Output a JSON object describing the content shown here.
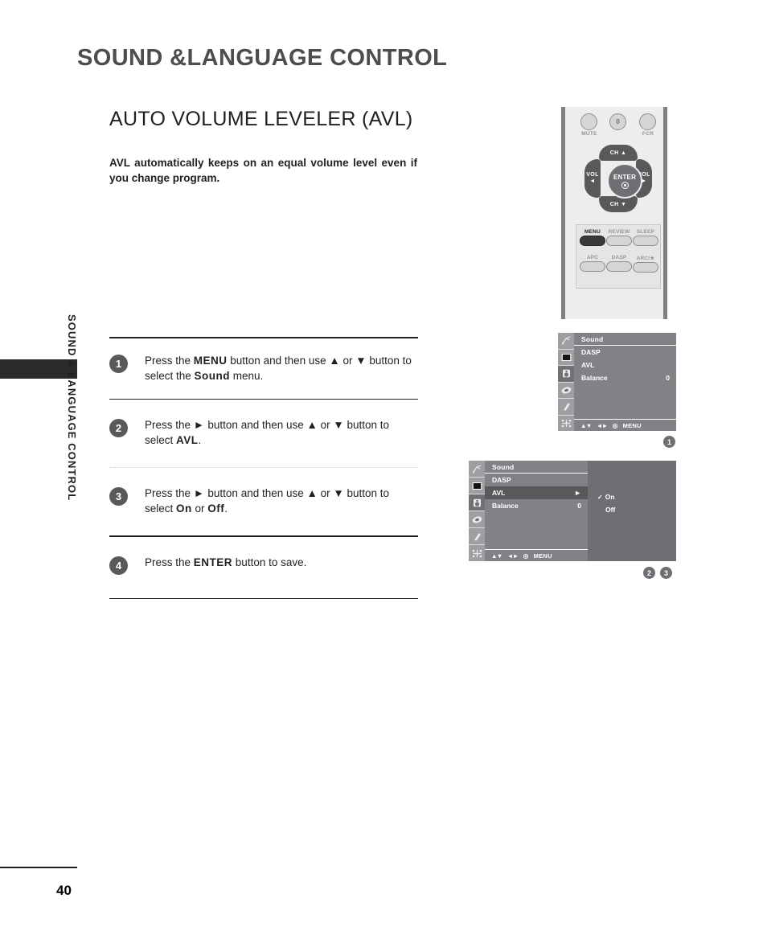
{
  "page": {
    "chapter_title": "SOUND &LANGUAGE CONTROL",
    "section_title": "AUTO VOLUME LEVELER (AVL)",
    "intro": "AVL automatically keeps on an equal volume level even if you change program.",
    "side_label": "SOUND & LANGUAGE CONTROL",
    "page_number": "40"
  },
  "steps": [
    {
      "num": "1",
      "parts": [
        {
          "t": "Press the ",
          "bold": false
        },
        {
          "t": "MENU",
          "bold": true
        },
        {
          "t": " button and then use ▲ or ▼ button to select the ",
          "bold": false
        },
        {
          "t": "Sound",
          "bold": true
        },
        {
          "t": " menu.",
          "bold": false
        }
      ]
    },
    {
      "num": "2",
      "parts": [
        {
          "t": "Press the ",
          "bold": false
        },
        {
          "t": "►",
          "bold": true
        },
        {
          "t": " button and then use ▲ or ▼ button to select ",
          "bold": false
        },
        {
          "t": "AVL",
          "bold": true
        },
        {
          "t": ".",
          "bold": false
        }
      ]
    },
    {
      "num": "3",
      "parts": [
        {
          "t": "Press the ",
          "bold": false
        },
        {
          "t": "►",
          "bold": true
        },
        {
          "t": " button and then use ▲ or ▼ button to select ",
          "bold": false
        },
        {
          "t": "On",
          "bold": true
        },
        {
          "t": " or ",
          "bold": false
        },
        {
          "t": "Off",
          "bold": true
        },
        {
          "t": ".",
          "bold": false
        }
      ]
    },
    {
      "num": "4",
      "parts": [
        {
          "t": "Press the ",
          "bold": false
        },
        {
          "t": "ENTER",
          "bold": true
        },
        {
          "t": " button to save.",
          "bold": false
        }
      ]
    }
  ],
  "remote": {
    "top_buttons": [
      {
        "label": "MUTE",
        "cap": ""
      },
      {
        "label": "",
        "cap": "0"
      },
      {
        "label": "FCR",
        "cap": ""
      }
    ],
    "navpad": {
      "up": "CH ▲",
      "down": "CH ▼",
      "left_label": "VOL",
      "left_arrow": "◄",
      "right_label": "VOL",
      "right_arrow": "►",
      "center": "ENTER"
    },
    "keypad": [
      {
        "label": "MENU",
        "active": true
      },
      {
        "label": "REVIEW",
        "active": false
      },
      {
        "label": "SLEEP",
        "active": false
      },
      {
        "label": "APC",
        "active": false
      },
      {
        "label": "DASP",
        "active": false
      },
      {
        "label": "ARC/★",
        "active": false
      }
    ]
  },
  "osd_icons": [
    {
      "name": "antenna-icon",
      "selected": false
    },
    {
      "name": "picture-icon",
      "selected": false
    },
    {
      "name": "sound-icon",
      "selected": true
    },
    {
      "name": "timer-icon",
      "selected": false
    },
    {
      "name": "special-icon",
      "selected": false
    },
    {
      "name": "screen-icon",
      "selected": false
    }
  ],
  "osd_footer": {
    "updown": "▲▼",
    "leftright": "◄►",
    "enter": "◎",
    "menu": "MENU"
  },
  "osd_1": {
    "header": "Sound",
    "rows": [
      {
        "name": "DASP",
        "value": "",
        "arrow": "",
        "highlight": false
      },
      {
        "name": "AVL",
        "value": "",
        "arrow": "",
        "highlight": false
      },
      {
        "name": "Balance",
        "value": "0",
        "arrow": "",
        "highlight": false
      }
    ]
  },
  "osd_2": {
    "header": "Sound",
    "rows": [
      {
        "name": "DASP",
        "value": "",
        "arrow": "",
        "highlight": false
      },
      {
        "name": "AVL",
        "value": "",
        "arrow": "►",
        "highlight": true
      },
      {
        "name": "Balance",
        "value": "0",
        "arrow": "",
        "highlight": false
      }
    ],
    "submenu": {
      "options": [
        {
          "label": "On",
          "checked": true
        },
        {
          "label": "Off",
          "checked": false
        }
      ],
      "check_glyph": "✓"
    }
  },
  "markers": {
    "osd1": "1",
    "osd2_a": "2",
    "osd2_b": "3"
  },
  "colors": {
    "chapter_gray": "#4d4d4f",
    "text": "#231f20",
    "badge_gray": "#58595b",
    "osd_bg": "#808285",
    "osd_icon_col": "#9d9fa2",
    "osd_highlight": "#58595b",
    "osd_submenu": "#6d6f72",
    "remote_body": "#eceded",
    "remote_edge": "#7e8083"
  }
}
